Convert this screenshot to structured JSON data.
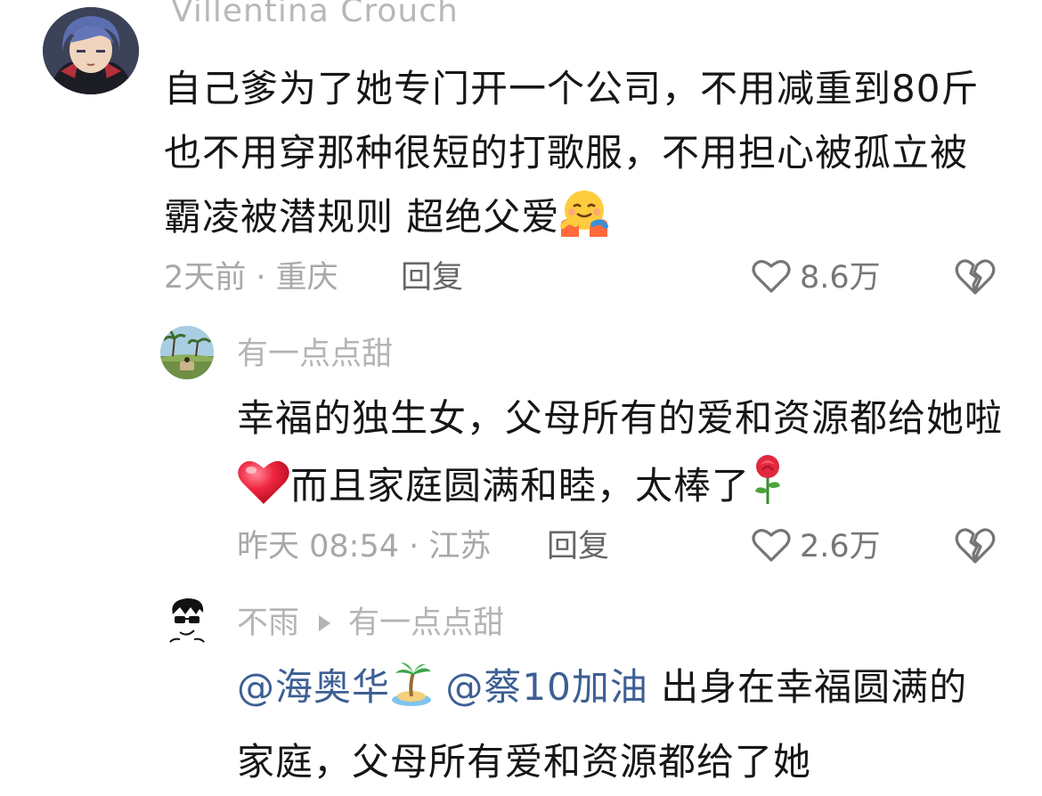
{
  "main_comment": {
    "username": "Villentina Crouch",
    "text": "自己爹为了她专门开一个公司，不用减重到80斤也不用穿那种很短的打歌服，不用担心被孤立被霸凌被潜规则 超绝父爱",
    "emoji": "hugging-face-emoji",
    "meta": "2天前 · 重庆",
    "reply_label": "回复",
    "likes": "8.6万"
  },
  "reply_1": {
    "username": "有一点点甜",
    "text_part1": "幸福的独生女，父母所有的爱和资源都给她啦",
    "emoji_heart": "red-heart-emoji",
    "text_part2": "而且家庭圆满和睦，太棒了",
    "emoji_rose": "rose-emoji",
    "meta": "昨天 08:54 · 江苏",
    "reply_label": "回复",
    "likes": "2.6万"
  },
  "reply_2": {
    "username": "不雨",
    "reply_to": "有一点点甜",
    "mention_1": "@海奥华",
    "emoji_island": "desert-island-emoji",
    "mention_2": "@蔡10加油",
    "text": " 出身在幸福圆满的家庭，父母所有爱和资源都给了她"
  },
  "colors": {
    "text": "#161616",
    "meta": "#a8a8a8",
    "mention": "#3d5f93",
    "icon": "#757575"
  }
}
